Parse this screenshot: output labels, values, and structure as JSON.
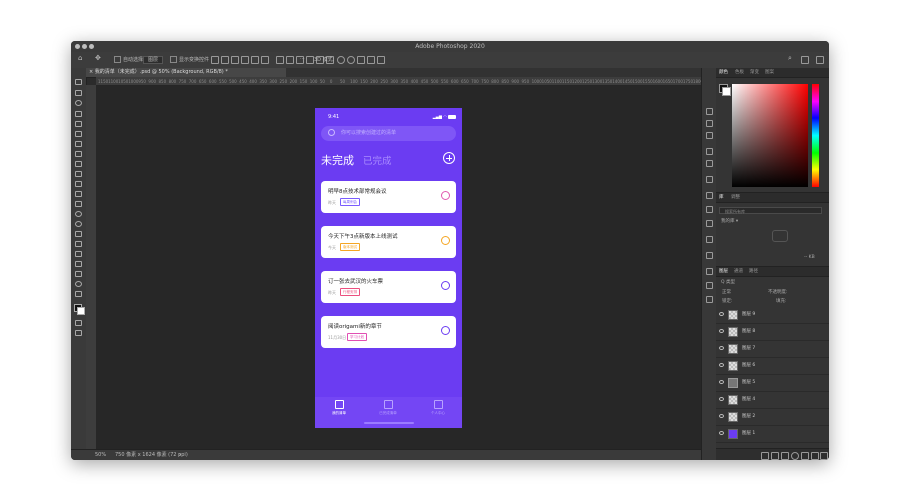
{
  "window": {
    "title": "Adobe Photoshop 2020"
  },
  "options_bar": {
    "auto_select_label": "自动选择:",
    "auto_select_value": "图层",
    "transform_controls_label": "显示变换控件",
    "more": "···",
    "three_d_mode": "3D 模式:"
  },
  "document_tab": {
    "label": "我的清单（未完成）.psd @ 50% (Background, RGB/8) *"
  },
  "ruler": {
    "ticks": [
      "1150",
      "1100",
      "1050",
      "1000",
      "950",
      "900",
      "850",
      "800",
      "750",
      "700",
      "650",
      "600",
      "550",
      "500",
      "450",
      "400",
      "350",
      "300",
      "250",
      "200",
      "150",
      "100",
      "50",
      "0",
      "50",
      "100",
      "150",
      "200",
      "250",
      "300",
      "350",
      "400",
      "450",
      "500",
      "550",
      "600",
      "650",
      "700",
      "750",
      "800",
      "850",
      "900",
      "950",
      "1000",
      "1050",
      "1100",
      "1150",
      "1200",
      "1250",
      "1300",
      "1350",
      "1400",
      "1450",
      "1500",
      "1550",
      "1600",
      "1650",
      "1700",
      "1750",
      "1800"
    ]
  },
  "status_bar": {
    "zoom": "50%",
    "doc_info": "750 像素 x 1624 像素 (72 ppi)"
  },
  "panels": {
    "color_tabs": [
      "颜色",
      "色板",
      "渐变",
      "图案"
    ],
    "properties_tabs": [
      "库",
      "调整"
    ],
    "search_placeholder": "搜索所有库",
    "library_label": "我的库",
    "library_dropdown": "我的库 ▾",
    "kb_label": "-- KB",
    "layers_tabs": [
      "图层",
      "通道",
      "路径"
    ],
    "layer_filter": "Q 类型",
    "blend_mode": "正常",
    "opacity_label": "不透明度:",
    "lock_label": "锁定:",
    "fill_label": "填充:",
    "layers": [
      {
        "name": "图层 9",
        "thumb": "checker"
      },
      {
        "name": "图层 8",
        "thumb": "checker"
      },
      {
        "name": "图层 7",
        "thumb": "checker"
      },
      {
        "name": "图层 6",
        "thumb": "checker"
      },
      {
        "name": "图层 5",
        "thumb": "folder"
      },
      {
        "name": "图层 4",
        "thumb": "checker"
      },
      {
        "name": "图层 2",
        "thumb": "checker"
      },
      {
        "name": "图层 1",
        "thumb": "purple"
      }
    ]
  },
  "phone": {
    "time": "9:41",
    "search_placeholder": "你可以搜索创建过的清单",
    "tab_active": "未完成",
    "tab_inactive": "已完成",
    "cards": [
      {
        "title": "明早8点技术部常规会议",
        "date": "昨天",
        "tag": "每周例会",
        "color": "#7a5cff"
      },
      {
        "title": "今天下午3点新版本上线测试",
        "date": "今天",
        "tag": "版本测试",
        "color": "#f5a623"
      },
      {
        "title": "订一张去武汉的火车票",
        "date": "昨天",
        "tag": "行程安排",
        "color": "#ec4f7f"
      },
      {
        "title": "阅读origami新的章节",
        "date": "11月30日",
        "tag": "学习计划",
        "color": "#e14fb3"
      }
    ],
    "nav": [
      {
        "label": "我的清单",
        "active": true
      },
      {
        "label": "已完成清单",
        "active": false
      },
      {
        "label": "个人中心",
        "active": false
      }
    ],
    "accent": "#6b3cf2"
  }
}
